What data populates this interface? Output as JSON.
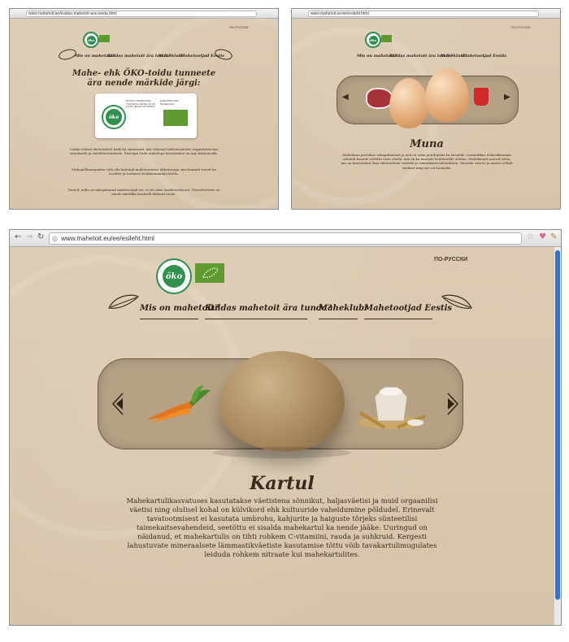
{
  "colors": {
    "paper": "#d9c8b0",
    "band": "#b6a185",
    "ink": "#3a2a1d",
    "eco_green": "#2f8f4e",
    "eu_green": "#5e9a2f"
  },
  "shot1": {
    "url": "www.mahetoit.ee/kuidas-mahetoit-ara-tunda.html",
    "lang": "ПО-РУССКИ",
    "nav": [
      "Mis on mahetoit?",
      "Kuidas mahetoit ära tunda?",
      "Maheklubi",
      "Mahetootjad Eestis"
    ],
    "heading": "Mahe- ehk ÖKO-toidu tunneete ära nende märkide järgi:",
    "label_left": "RIIKLIKU MAHETOIDU TOODETE LOETELUS ON OSTE TEGIJA TOODANG",
    "label_right": "EUROOPA LIIDU MAHELOGO",
    "para1": "Lisaks võivad ökotoodetel leida ka tunnuseid, mis viitavad rahvusvahelise organisatsiooni esindusele ja sertifitseerimisele. Euroopa Liidu mahelogo kasutamine on aga kohustuslik.",
    "para2": "Mahepõllumajandus võib olla kaitstud mahetootmise tähistusega, mis kannab teavet ka toodete ja tootmise keskkonnamõju kohta.",
    "para3": "Tooted, mille on märgistanud mahetootjad ise, ei ole alati usaldusväärsed. Tõsiseltvõetav on ainult ametliku kontrolli läbinud toode."
  },
  "shot2": {
    "url": "www.mahetoit.ee/ee/esileht.html",
    "lang": "ПО-РУССКИ",
    "nav": [
      "Mis on mahetoit?",
      "Kuidas mahetoit ära tunda?",
      "Maheklubi",
      "Mahetootjad Eestis"
    ],
    "product_title": "Muna",
    "description": "Mahekanu peetakse vabapidamisel ja neil on vaba juurdepääs ka õuealale. Loomulikus elukeskkonnas eelistab kanade söötdes toitu otsida, mis on ka munade kvaliteedile oluline. Mahekanad saavad sööta, mis on kasvatatud ilma sünteetiliste väetiste ja taimekaitsevahenditeta. Munade värvus ja maitse sõltub söödast ning see on loomulik."
  },
  "shot3": {
    "url": "www.mahetoit.eu/ee/esileht.html",
    "lang": "ПО-РУССКИ",
    "nav": [
      "Mis on mahetoit?",
      "Kuidas mahetoit ära tunda?",
      "Maheklubi",
      "Mahetootjad Eestis"
    ],
    "logo_text": "öko",
    "product_title": "Kartul",
    "description": "Mahekartulikasvatuses kasutatakse väetistena sõnnikut, haljasväetisi ja muid orgaanilisi väetisi ning olulisel kohal on külvikord ehk kultuuride vaheldumine põldudel. Erinevalt tavatootmisest ei kasutata umbrohu, kahjurite ja haiguste tõrjeks sünteetilisi taimekaitsevahendeid, seetõttu ei sisalda mahekartul ka nende jääke. Uuringud on näidanud, et mahekartulis on tihti rohkem C-vitamiini, rauda ja suhkruid. Kergesti lahustuvate mineraalsete lämmastikväetiste kasutamise tõttu võib tavakartulimugulates leiduda rohkem nitraate kui mahekartulites."
  }
}
